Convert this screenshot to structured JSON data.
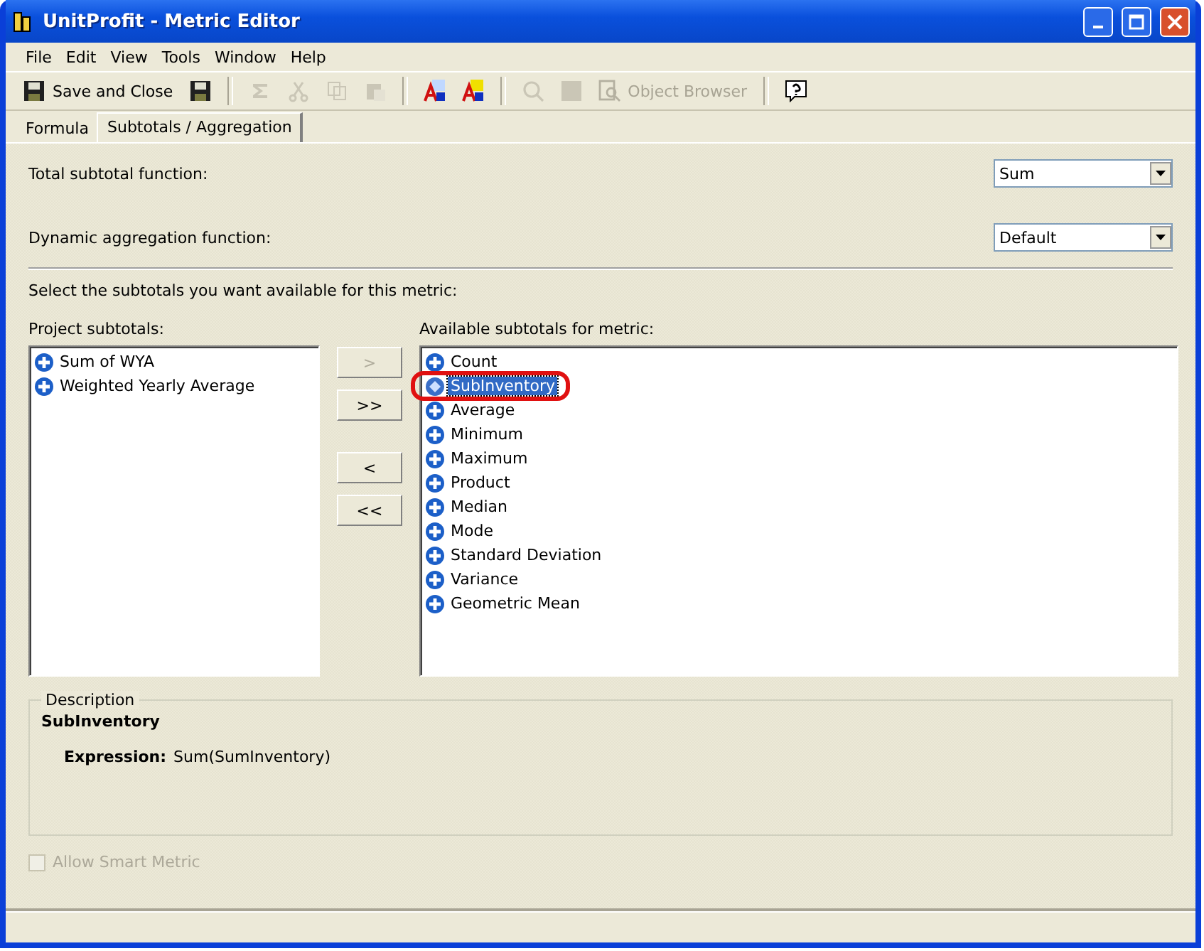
{
  "window": {
    "title": "UnitProfit - Metric Editor"
  },
  "menu": [
    "File",
    "Edit",
    "View",
    "Tools",
    "Window",
    "Help"
  ],
  "toolbar": [
    {
      "kind": "save",
      "label": "Save and Close",
      "disabled": false
    },
    {
      "kind": "saveicon",
      "disabled": false
    },
    {
      "kind": "sep"
    },
    {
      "kind": "sum",
      "disabled": true
    },
    {
      "kind": "cut",
      "disabled": true
    },
    {
      "kind": "copy",
      "disabled": true
    },
    {
      "kind": "paste",
      "disabled": true
    },
    {
      "kind": "sep"
    },
    {
      "kind": "abc",
      "disabled": false
    },
    {
      "kind": "abc2",
      "disabled": false
    },
    {
      "kind": "sep"
    },
    {
      "kind": "find",
      "disabled": true
    },
    {
      "kind": "block",
      "disabled": true
    },
    {
      "kind": "browser",
      "label": "Object Browser",
      "disabled": true
    },
    {
      "kind": "sep"
    },
    {
      "kind": "help",
      "disabled": false
    }
  ],
  "tabs": [
    {
      "label": "Formula",
      "selected": false
    },
    {
      "label": "Subtotals / Aggregation",
      "selected": true
    }
  ],
  "total_subtotal": {
    "label": "Total subtotal function:",
    "value": "Sum"
  },
  "dynamic_aggregation": {
    "label": "Dynamic aggregation function:",
    "value": "Default"
  },
  "instruction": "Select the subtotals you want available for this metric:",
  "project_subtotals": {
    "label": "Project subtotals:",
    "items": [
      {
        "label": "Sum of WYA",
        "kind": "plus",
        "selected": false,
        "circled": false
      },
      {
        "label": "Weighted Yearly Average",
        "kind": "plus",
        "selected": false,
        "circled": false
      }
    ]
  },
  "transfer_buttons": [
    {
      "label": ">",
      "disabled": true
    },
    {
      "label": ">>",
      "disabled": false
    },
    {
      "label": "<",
      "disabled": false
    },
    {
      "label": "<<",
      "disabled": false
    }
  ],
  "available_subtotals": {
    "label": "Available subtotals for metric:",
    "items": [
      {
        "label": "Count",
        "kind": "plus",
        "selected": false,
        "circled": false
      },
      {
        "label": "SubInventory",
        "kind": "diamond",
        "selected": true,
        "circled": true
      },
      {
        "label": "Average",
        "kind": "plus",
        "selected": false,
        "circled": false
      },
      {
        "label": "Minimum",
        "kind": "plus",
        "selected": false,
        "circled": false
      },
      {
        "label": "Maximum",
        "kind": "plus",
        "selected": false,
        "circled": false
      },
      {
        "label": "Product",
        "kind": "plus",
        "selected": false,
        "circled": false
      },
      {
        "label": "Median",
        "kind": "plus",
        "selected": false,
        "circled": false
      },
      {
        "label": "Mode",
        "kind": "plus",
        "selected": false,
        "circled": false
      },
      {
        "label": "Standard Deviation",
        "kind": "plus",
        "selected": false,
        "circled": false
      },
      {
        "label": "Variance",
        "kind": "plus",
        "selected": false,
        "circled": false
      },
      {
        "label": "Geometric Mean",
        "kind": "plus",
        "selected": false,
        "circled": false
      }
    ]
  },
  "description": {
    "legend": "Description",
    "name": "SubInventory",
    "expression_label": "Expression:",
    "expression": "Sum(SumInventory)"
  },
  "smart_metric": {
    "label": "Allow Smart Metric",
    "checked": false,
    "disabled": true
  }
}
